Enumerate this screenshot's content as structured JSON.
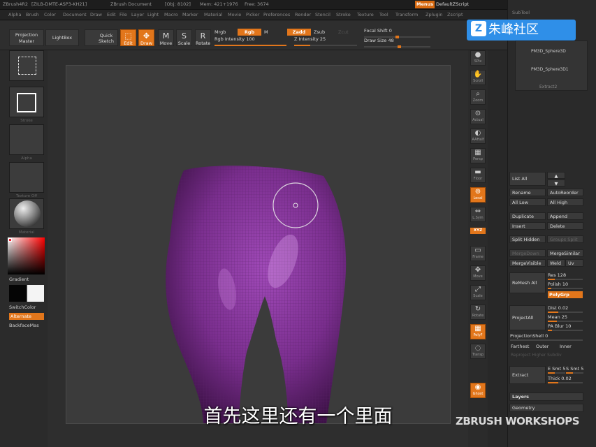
{
  "title_bar": {
    "app": "ZBrush4R2",
    "build": "[ZILB-DMTE-ASP3-KH21]",
    "doc": "ZBrush Document",
    "obj": "[Obj: 8102]",
    "mem": "Mem: 421+1976",
    "free": "Free: 3674",
    "menus_label": "Menus",
    "script_label": "DefaultZScript"
  },
  "menubar": [
    "Alpha",
    "Brush",
    "Color",
    "Document",
    "Draw",
    "Edit",
    "File",
    "Layer",
    "Light",
    "Macro",
    "Marker",
    "Material",
    "Movie",
    "Picker",
    "Preferences",
    "Render",
    "Stencil",
    "Stroke",
    "Texture",
    "Tool",
    "Transform",
    "Zplugin",
    "Zscript"
  ],
  "toolbar": {
    "projection_master": "Projection Master",
    "lightbox": "LightBox",
    "quick_sketch": "Quick Sketch",
    "edit": "Edit",
    "draw": "Draw",
    "move": "Move",
    "scale": "Scale",
    "rotate": "Rotate",
    "mrgb": "Mrgb",
    "rgb": "Rgb",
    "m": "M",
    "rgb_intensity_label": "Rgb Intensity 100",
    "rgb_intensity": 100,
    "zadd": "Zadd",
    "zsub": "Zsub",
    "zcut": "Zcut",
    "z_intensity_label": "Z Intensity 25",
    "z_intensity": 25,
    "focal_shift_label": "Focal Shift 0",
    "focal_shift": 0,
    "draw_size_label": "Draw Size 48",
    "draw_size": 48
  },
  "left_shelf": {
    "thumb_labels": [
      "Stroke",
      "Alpha",
      "Texture Off",
      "Material"
    ],
    "gradient": "Gradient",
    "switch_color": "SwitchColor",
    "alternate": "Alternate",
    "backface_mask": "BackfaceMas"
  },
  "right_shelf": {
    "buttons": [
      {
        "label": "SPix",
        "icon": "sphere-icon",
        "active": false
      },
      {
        "label": "Scroll",
        "icon": "hand-icon",
        "active": false
      },
      {
        "label": "Zoom",
        "icon": "zoom-icon",
        "active": false
      },
      {
        "label": "Actual",
        "icon": "actual-icon",
        "active": false
      },
      {
        "label": "AAHalf",
        "icon": "aahalf-icon",
        "active": false
      },
      {
        "label": "Persp",
        "icon": "persp-icon",
        "active": false
      },
      {
        "label": "Floor",
        "icon": "floor-icon",
        "active": false
      },
      {
        "label": "Local",
        "icon": "local-icon",
        "active": true
      },
      {
        "label": "L.Sym",
        "icon": "lsym-icon",
        "active": false
      },
      {
        "label": "Frame",
        "icon": "frame-icon",
        "active": false
      },
      {
        "label": "Move",
        "icon": "move-icon",
        "active": false
      },
      {
        "label": "Scale",
        "icon": "scale-icon",
        "active": false
      },
      {
        "label": "Rotate",
        "icon": "rotate-icon",
        "active": false
      },
      {
        "label": "PolyF",
        "icon": "polyframe-icon",
        "active": true
      },
      {
        "label": "Transp",
        "icon": "transp-icon",
        "active": false
      },
      {
        "label": "Ghost",
        "icon": "ghost-icon",
        "active": true
      }
    ],
    "xyz_label": "XYZ"
  },
  "subtool_panel": {
    "header": "SubTool",
    "items": [
      "PM3D_Sphere3D",
      "PM3D_Sphere3D1"
    ],
    "extract_label": "Extract2",
    "list_all": "List All",
    "rename": "Rename",
    "auto_reorder": "AutoReorder",
    "all_low": "All Low",
    "all_high": "All High",
    "duplicate": "Duplicate",
    "append": "Append",
    "insert": "Insert",
    "delete": "Delete",
    "split_hidden": "Split Hidden",
    "groups_split": "Groups Split",
    "merge_down": "MergeDown",
    "merge_similar": "MergeSimilar",
    "merge_visible": "MergeVisible",
    "weld": "Weld",
    "uv": "Uv",
    "remesh_all": "ReMesh All",
    "res_label": "Res 128",
    "res": 128,
    "polish_label": "Polish 10",
    "polish": 10,
    "polygrp": "PolyGrp",
    "project_all": "ProjectAll",
    "dist_label": "Dist 0.02",
    "dist": 0.02,
    "mean_label": "Mean 25",
    "mean": 25,
    "pa_blur_label": "PA Blur 10",
    "pa_blur": 10,
    "projection_shell_label": "ProjectionShell 0",
    "projection_shell": 0,
    "farthest": "Farthest",
    "outer": "Outer",
    "inner": "Inner",
    "reproject_higher": "Reproject Higher Subdiv",
    "extract": "Extract",
    "e_smt_label": "E Smt 5",
    "s_smt_label": "S Smt 5",
    "thick_label": "Thick 0.02",
    "thick": 0.02,
    "layers": "Layers",
    "geometry": "Geometry"
  },
  "overlays": {
    "watermark_text": "朱峰社区",
    "subtitle": "首先这里还有一个里面",
    "zbrush_workshops": "ZBRUSH WORKSHOPS"
  },
  "colors": {
    "accent": "#e2761b",
    "mesh": "#7a2e8e",
    "watermark_bg": "#2f8fe8"
  }
}
